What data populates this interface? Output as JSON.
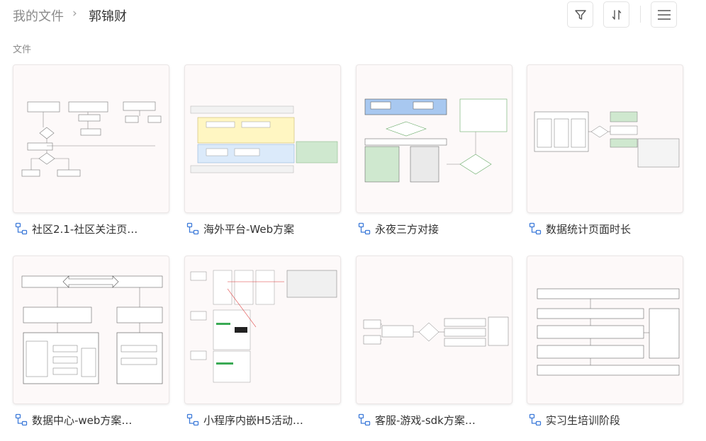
{
  "breadcrumb": {
    "root": "我的文件",
    "separator": "›",
    "current": "郭锦财"
  },
  "toolbar": {
    "filter_icon": "filter-icon",
    "sort_icon": "sort-icon",
    "menu_icon": "menu-icon"
  },
  "section": {
    "label": "文件"
  },
  "files": [
    {
      "name": "社区2.1-社区关注页…",
      "icon": "flowchart-icon"
    },
    {
      "name": "海外平台-Web方案",
      "icon": "flowchart-icon"
    },
    {
      "name": "永夜三方对接",
      "icon": "flowchart-icon"
    },
    {
      "name": "数据统计页面时长",
      "icon": "flowchart-icon"
    },
    {
      "name": "数据中心-web方案…",
      "icon": "flowchart-icon"
    },
    {
      "name": "小程序内嵌H5活动…",
      "icon": "flowchart-icon"
    },
    {
      "name": "客服-游戏-sdk方案…",
      "icon": "flowchart-icon"
    },
    {
      "name": "实习生培训阶段",
      "icon": "flowchart-icon"
    }
  ],
  "colors": {
    "icon_blue": "#3c7ad9",
    "thumb_bg": "#fdf9f9",
    "diagram_blue": "#a8c8f0",
    "diagram_yellow": "#fff6c2",
    "diagram_green": "#cfe8cf",
    "diagram_lightblue": "#dbeafa"
  }
}
